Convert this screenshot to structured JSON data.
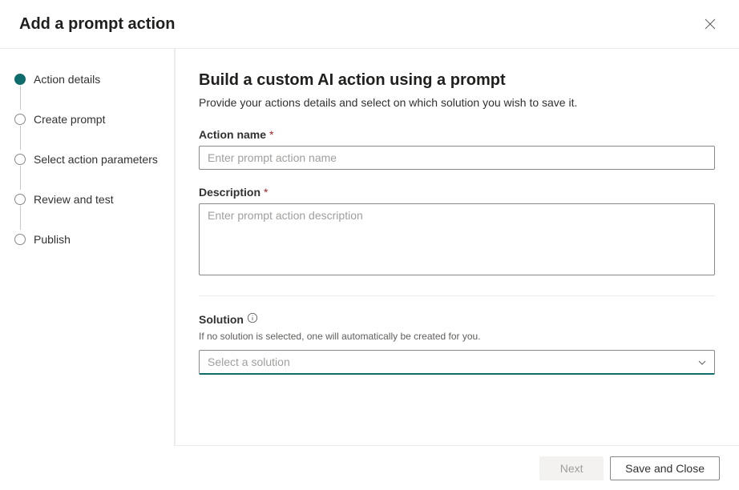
{
  "header": {
    "title": "Add a prompt action"
  },
  "stepper": {
    "steps": [
      {
        "label": "Action details",
        "active": true
      },
      {
        "label": "Create prompt",
        "active": false
      },
      {
        "label": "Select action parameters",
        "active": false
      },
      {
        "label": "Review and test",
        "active": false
      },
      {
        "label": "Publish",
        "active": false
      }
    ]
  },
  "main": {
    "title": "Build a custom AI action using a prompt",
    "subtitle": "Provide your actions details and select on which solution you wish to save it.",
    "action_name": {
      "label": "Action name",
      "placeholder": "Enter prompt action name",
      "value": ""
    },
    "description": {
      "label": "Description",
      "placeholder": "Enter prompt action description",
      "value": ""
    },
    "solution": {
      "label": "Solution",
      "helper": "If no solution is selected, one will automatically be created for you.",
      "placeholder": "Select a solution",
      "value": ""
    },
    "required_marker": "*"
  },
  "footer": {
    "next_label": "Next",
    "save_close_label": "Save and Close"
  }
}
